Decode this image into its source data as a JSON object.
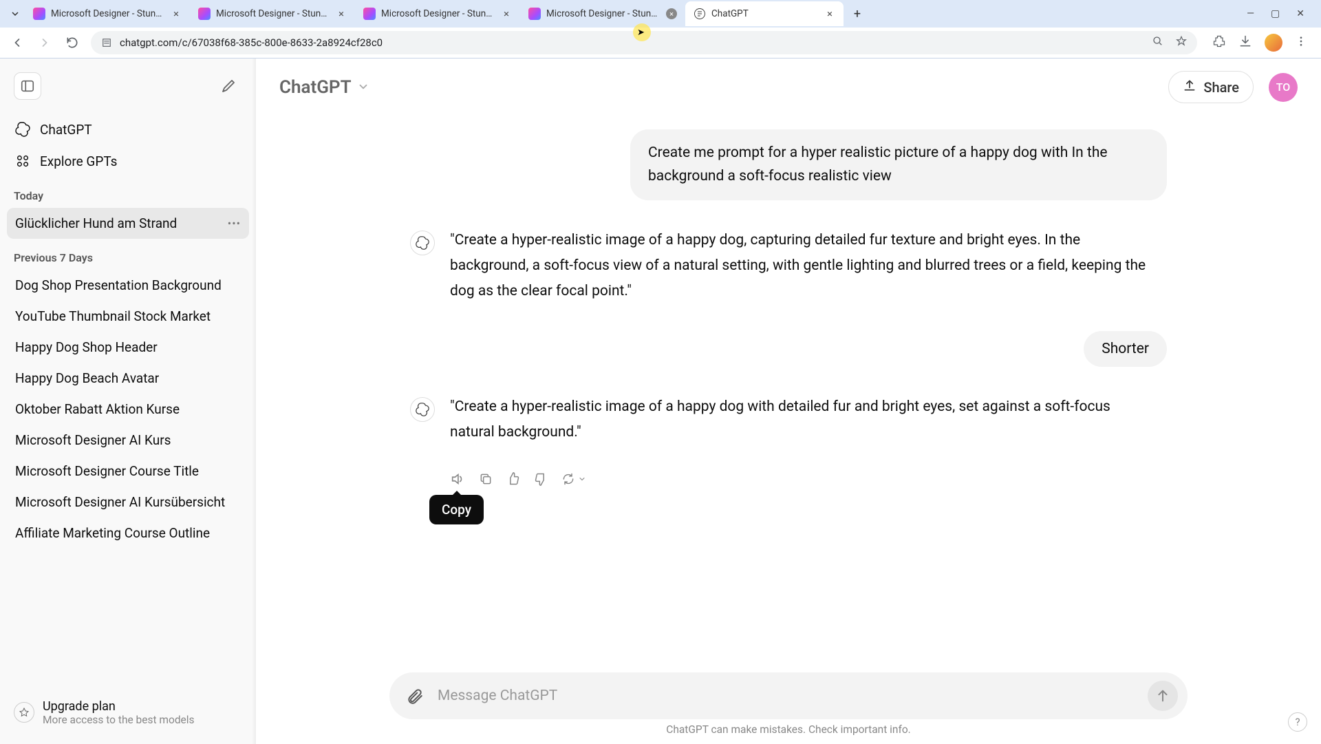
{
  "browser": {
    "tabs": [
      {
        "title": "Microsoft Designer - Stunning",
        "type": "designer"
      },
      {
        "title": "Microsoft Designer - Stunning",
        "type": "designer"
      },
      {
        "title": "Microsoft Designer - Stunning",
        "type": "designer"
      },
      {
        "title": "Microsoft Designer - Stunning",
        "type": "designer"
      },
      {
        "title": "ChatGPT",
        "type": "chatgpt",
        "active": true
      }
    ],
    "url": "chatgpt.com/c/67038f68-385c-800e-8633-2a8924cf28c0"
  },
  "sidebar": {
    "nav": {
      "chatgpt": "ChatGPT",
      "explore": "Explore GPTs"
    },
    "today_label": "Today",
    "today_items": [
      "Glücklicher Hund am Strand"
    ],
    "prev7_label": "Previous 7 Days",
    "prev7_items": [
      "Dog Shop Presentation Background",
      "YouTube Thumbnail Stock Market",
      "Happy Dog Shop Header",
      "Happy Dog Beach Avatar",
      "Oktober Rabatt Aktion Kurse",
      "Microsoft Designer AI Kurs",
      "Microsoft Designer Course Title",
      "Microsoft Designer AI Kursübersicht",
      "Affiliate Marketing Course Outline"
    ],
    "upgrade": {
      "title": "Upgrade plan",
      "sub": "More access to the best models"
    }
  },
  "header": {
    "model": "ChatGPT",
    "share": "Share",
    "avatar": "TO"
  },
  "conversation": {
    "user1": "Create me prompt for a hyper realistic picture of a happy dog with In the background a soft-focus realistic view",
    "assistant1": "\"Create a hyper-realistic image of a happy dog, capturing detailed fur texture and bright eyes. In the background, a soft-focus view of a natural setting, with gentle lighting and blurred trees or a field, keeping the dog as the clear focal point.\"",
    "user2": "Shorter",
    "assistant2": "\"Create a hyper-realistic image of a happy dog with detailed fur and bright eyes, set against a soft-focus natural background.\"",
    "tooltip_copy": "Copy"
  },
  "composer": {
    "placeholder": "Message ChatGPT"
  },
  "disclaimer": "ChatGPT can make mistakes. Check important info.",
  "help": "?"
}
